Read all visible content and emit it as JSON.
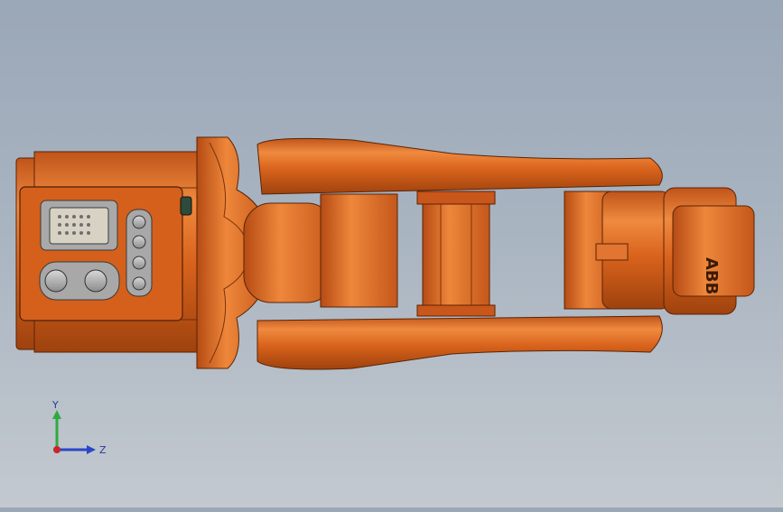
{
  "viewport": {
    "background_top": "#9aa7b7",
    "background_bottom": "#c3c9cf",
    "model_color": "#d9631c",
    "model_highlight": "#f08a3e",
    "model_shadow": "#a8460f"
  },
  "model": {
    "brand_label": "ABB"
  },
  "triad": {
    "y_label": "Y",
    "z_label": "Z",
    "y_color": "#2faa3f",
    "z_color": "#2a46c8",
    "x_color": "#c8262a"
  }
}
